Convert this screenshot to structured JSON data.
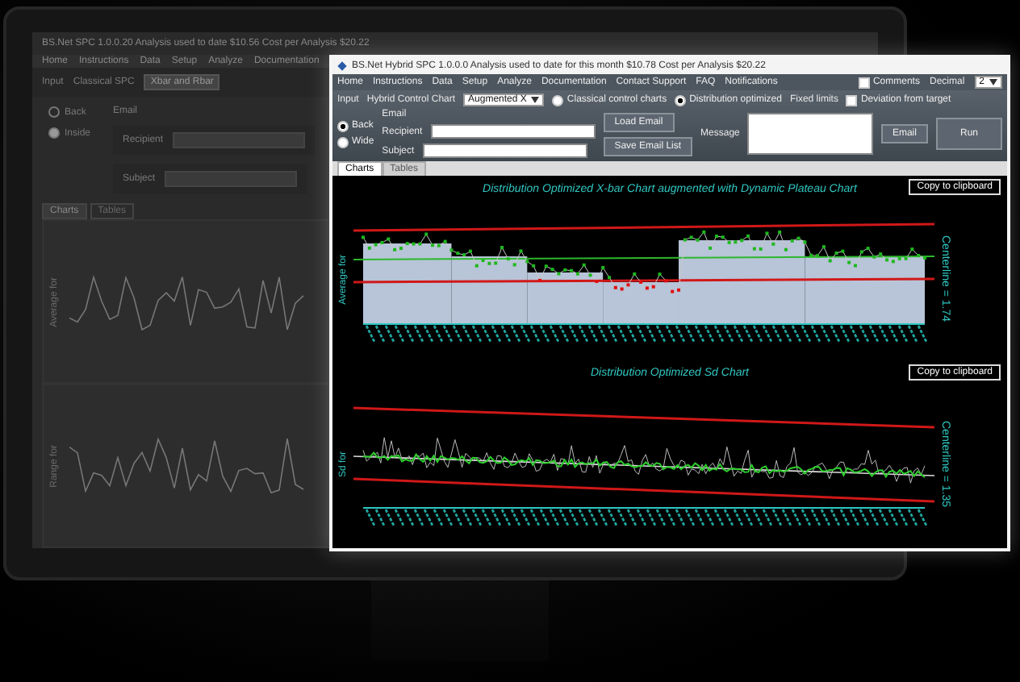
{
  "monitor_screen": {
    "title": "BS.Net SPC 1.0.0.20 Analysis used to date $10.56 Cost per Analysis $20.22",
    "menu": [
      "Home",
      "Instructions",
      "Data",
      "Setup",
      "Analyze",
      "Documentation"
    ],
    "input_label": "Input",
    "chart_type_label": "Classical SPC",
    "chart_type_value": "Xbar and Rbar",
    "radios": [
      {
        "label": "Back",
        "selected": false
      },
      {
        "label": "Inside",
        "selected": true
      }
    ],
    "email_label": "Email",
    "recipient_label": "Recipient",
    "subject_label": "Subject",
    "tabs": [
      {
        "label": "Charts",
        "selected": true
      },
      {
        "label": "Tables",
        "selected": false
      }
    ],
    "charts": [
      {
        "ylabel": "Average for"
      },
      {
        "ylabel": "Range for"
      }
    ]
  },
  "window": {
    "title": "BS.Net Hybrid SPC 1.0.0.0 Analysis used to date for this month $10.78 Cost per Analysis $20.22",
    "menu": [
      "Home",
      "Instructions",
      "Data",
      "Setup",
      "Analyze",
      "Documentation",
      "Contact Support",
      "FAQ",
      "Notifications"
    ],
    "input_label": "Input",
    "chart_type_label": "Hybrid Control Chart",
    "chart_type_value": "Augmented X",
    "modes": [
      {
        "label": "Classical control charts",
        "selected": false
      },
      {
        "label": "Distribution optimized",
        "selected": true
      }
    ],
    "fixed_limits_label": "Fixed limits",
    "deviation": {
      "label": "Deviation from target",
      "checked": false
    },
    "comments": {
      "label": "Comments",
      "checked": false
    },
    "decimal_label": "Decimal",
    "decimal_value": "2",
    "run_button": "Run",
    "sides": [
      {
        "label": "Back",
        "selected": true
      },
      {
        "label": "Wide",
        "selected": false
      }
    ],
    "email_label": "Email",
    "recipient_label": "Recipient",
    "subject_label": "Subject",
    "load_button": "Load Email",
    "save_button": "Save Email List",
    "message_label": "Message",
    "email_button": "Email",
    "tabs": [
      {
        "label": "Charts",
        "selected": true
      },
      {
        "label": "Tables",
        "selected": false
      }
    ],
    "charts": [
      {
        "kind": "xbar",
        "title": "Distribution Optimized X-bar Chart augmented with Dynamic Plateau Chart",
        "ylabel": "Average for",
        "centerline": "Centerline = 1.74",
        "copy_button": "Copy to clipboard"
      },
      {
        "kind": "sd",
        "title": "Distribution Optimized Sd Chart",
        "ylabel": "Sd for",
        "centerline": "Centerline = 1.35",
        "copy_button": "Copy to clipboard"
      }
    ]
  }
}
